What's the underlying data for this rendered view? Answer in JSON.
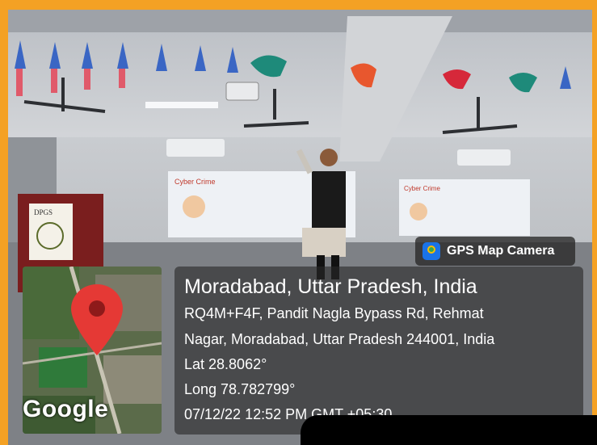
{
  "gps_badge": {
    "label": "GPS Map Camera",
    "icon": "gps-map-camera-icon"
  },
  "location": {
    "title": "Moradabad, Uttar Pradesh, India",
    "address_line1": "RQ4M+F4F, Pandit Nagla Bypass Rd, Rehmat",
    "address_line2": "Nagar, Moradabad, Uttar Pradesh 244001, India",
    "lat": "Lat 28.8062°",
    "long": "Long 78.782799°",
    "datetime": "07/12/22 12:52 PM GMT +05:30"
  },
  "map": {
    "brand": "Google",
    "pin_icon": "map-pin-icon"
  },
  "scene": {
    "slide_left_title": "Cyber Crime",
    "slide_right_title": "Cyber Crime",
    "podium_logo": "DPGS"
  },
  "colors": {
    "border": "#f4a124",
    "pin": "#e53935",
    "overlay": "#282828"
  }
}
